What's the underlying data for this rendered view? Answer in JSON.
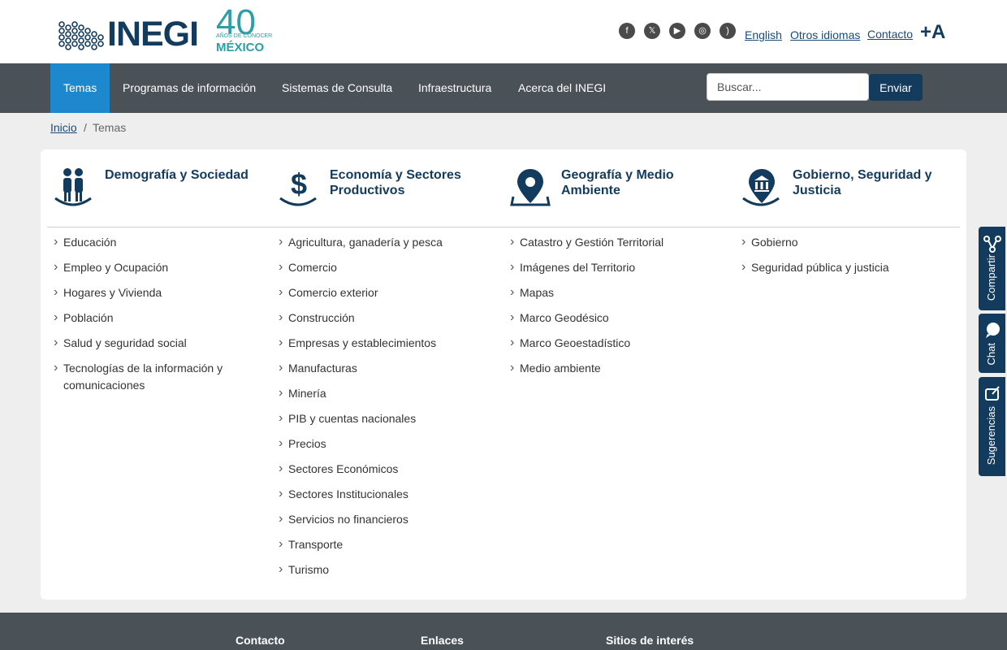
{
  "brand": {
    "name": "INEGI",
    "anniversary_number": "40",
    "anniversary_text": "AÑOS DE CONOCER",
    "anniversary_country": "MÉXICO"
  },
  "social_icons": [
    "facebook-icon",
    "x-icon",
    "youtube-icon",
    "instagram-icon",
    "rss-icon"
  ],
  "top_links": {
    "english": "English",
    "other_languages": "Otros idiomas",
    "contact": "Contacto",
    "font_size": "+A"
  },
  "nav": {
    "items": [
      {
        "label": "Temas"
      },
      {
        "label": "Programas de información"
      },
      {
        "label": "Sistemas de Consulta"
      },
      {
        "label": "Infraestructura"
      },
      {
        "label": "Acerca del INEGI"
      }
    ],
    "active": "Temas"
  },
  "search": {
    "placeholder": "Buscar...",
    "submit": "Enviar"
  },
  "breadcrumb": {
    "home": "Inicio",
    "separator": "/",
    "current": "Temas"
  },
  "columns": [
    {
      "title": "Demografía y Sociedad",
      "icon": "people-icon",
      "items": [
        "Educación",
        "Empleo y Ocupación",
        "Hogares y Vivienda",
        "Población",
        "Salud y seguridad social",
        "Tecnologías de la información y comunicaciones"
      ]
    },
    {
      "title": "Economía y Sectores Productivos",
      "icon": "dollar-icon",
      "items": [
        "Agricultura, ganadería y pesca",
        "Comercio",
        "Comercio exterior",
        "Construcción",
        "Empresas y establecimientos",
        "Manufacturas",
        "Minería",
        "PIB y cuentas nacionales",
        "Precios",
        "Sectores Económicos",
        "Sectores Institucionales",
        "Servicios no financieros",
        "Transporte",
        "Turismo"
      ]
    },
    {
      "title": "Geografía y Medio Ambiente",
      "icon": "map-pin-icon",
      "items": [
        "Catastro y Gestión Territorial",
        "Imágenes del Territorio",
        "Mapas",
        "Marco Geodésico",
        "Marco Geoestadístico",
        "Medio ambiente"
      ]
    },
    {
      "title": "Gobierno, Seguridad y Justicia",
      "icon": "government-icon",
      "items": [
        "Gobierno",
        "Seguridad pública y justicia"
      ]
    }
  ],
  "side_tabs": {
    "share": "Compartir",
    "chat": "Chat",
    "suggestions": "Sugerencias"
  },
  "footer": {
    "contact": "Contacto",
    "links": "Enlaces",
    "sites": "Sitios de interés"
  },
  "colors": {
    "navbar": "#4a5157",
    "active_tab": "#1e88cf",
    "brand_navy": "#123b5d",
    "teal": "#2b9ea6"
  }
}
